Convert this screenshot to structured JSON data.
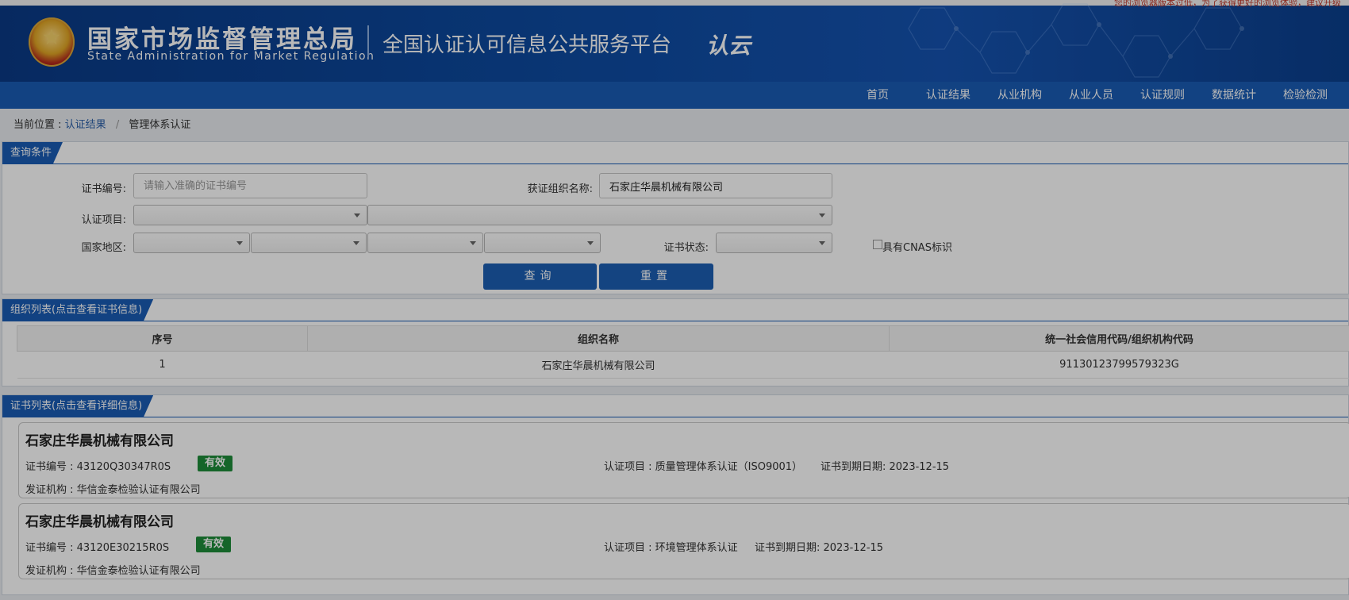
{
  "header": {
    "top_notice": "您的浏览器版本过低，为了获得更好的浏览体验，建议升级",
    "agency_name": "国家市场监督管理总局",
    "agency_name_en": "State Administration  for  Market Regulation",
    "platform_name": "全国认证认可信息公共服务平台",
    "logo_text": "认云"
  },
  "nav": {
    "items": [
      {
        "label": "首页"
      },
      {
        "label": "认证结果"
      },
      {
        "label": "从业机构"
      },
      {
        "label": "从业人员"
      },
      {
        "label": "认证规则"
      },
      {
        "label": "数据统计"
      },
      {
        "label": "检验检测"
      }
    ]
  },
  "breadcrumb": {
    "prefix": "当前位置 :",
    "link": "认证结果",
    "separator": "/",
    "current": "管理体系认证"
  },
  "query": {
    "title": "查询条件",
    "cert_no_label": "证书编号:",
    "cert_no_placeholder": "请输入准确的证书编号",
    "org_name_label": "获证组织名称:",
    "org_name_value": "石家庄华晨机械有限公司",
    "project_label": "认证项目:",
    "region_label": "国家地区:",
    "status_label": "证书状态:",
    "cnas_label": "具有CNAS标识",
    "search_button": "查询",
    "reset_button": "重置"
  },
  "org_list": {
    "title": "组织列表(点击查看证书信息)",
    "columns": [
      "序号",
      "组织名称",
      "统一社会信用代码/组织机构代码"
    ],
    "rows": [
      {
        "index": "1",
        "name": "石家庄华晨机械有限公司",
        "code": "91130123799579323G"
      }
    ]
  },
  "cert_list": {
    "title": "证书列表(点击查看详细信息)",
    "cards": [
      {
        "org": "石家庄华晨机械有限公司",
        "cert_no": "证书编号 : 43120Q30347R0S",
        "status": "有效",
        "project": "认证项目 : 质量管理体系认证（ISO9001）",
        "expiry": "证书到期日期: 2023-12-15",
        "issuer": "发证机构 : 华信金泰检验认证有限公司"
      },
      {
        "org": "石家庄华晨机械有限公司",
        "cert_no": "证书编号 : 43120E30215R0S",
        "status": "有效",
        "project": "认证项目 : 环境管理体系认证",
        "expiry": "证书到期日期: 2023-12-15",
        "issuer": "发证机构 : 华信金泰检验认证有限公司"
      }
    ]
  },
  "colors": {
    "header_blue": "#0d4aa0",
    "nav_blue": "#1a5cb4",
    "valid_green": "#1e8c39"
  }
}
